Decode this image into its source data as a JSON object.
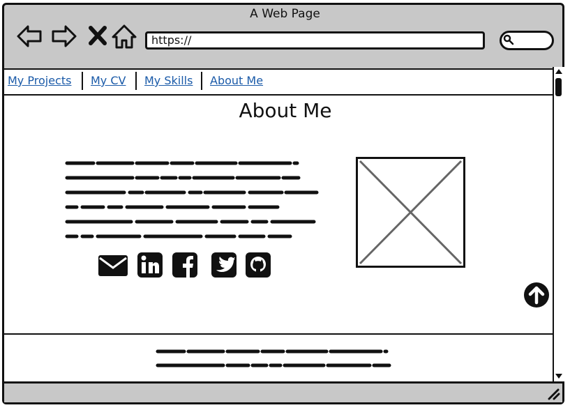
{
  "window": {
    "title": "A Web Page"
  },
  "address_bar": {
    "url": "https://"
  },
  "nav_tabs": [
    {
      "label": "My Projects"
    },
    {
      "label": "My CV"
    },
    {
      "label": "My Skills"
    },
    {
      "label": "About Me"
    }
  ],
  "main": {
    "heading": "About Me",
    "image_placeholder": "image-placeholder",
    "social_icons": [
      "envelope-icon",
      "linkedin-icon",
      "facebook-icon",
      "twitter-icon",
      "github-icon"
    ]
  },
  "icons": {
    "back": "arrow-left-icon",
    "forward": "arrow-right-icon",
    "stop": "close-icon",
    "home": "home-icon",
    "search": "search-icon",
    "scroll_top": "arrow-up-circle-icon",
    "resize": "resize-grip-icon"
  },
  "colors": {
    "link": "#1a5aa8",
    "chrome": "#c8c8c8"
  }
}
